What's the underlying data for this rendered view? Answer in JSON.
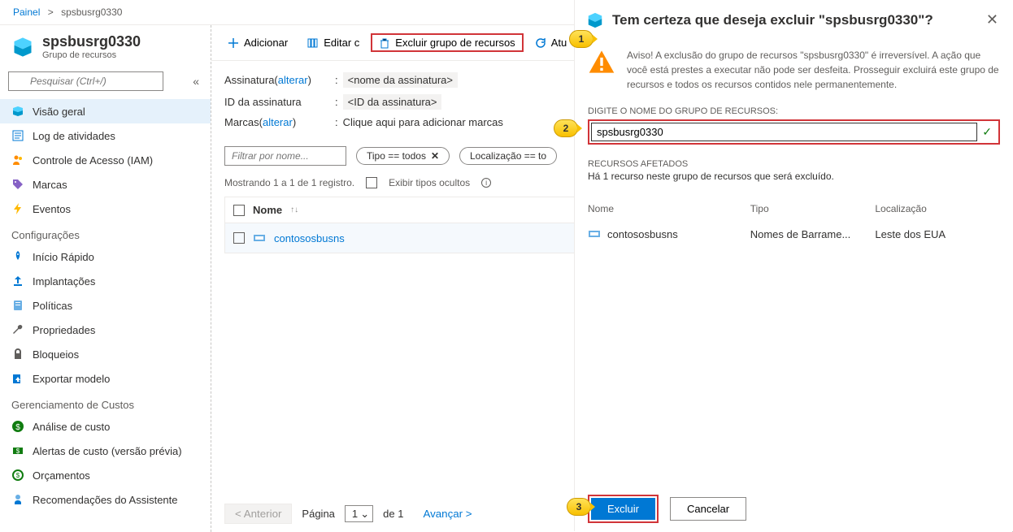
{
  "breadcrumb": {
    "root": "Painel",
    "current": "spsbusrg0330"
  },
  "header": {
    "title": "spsbusrg0330",
    "subtitle": "Grupo de recursos"
  },
  "search": {
    "placeholder": "Pesquisar (Ctrl+/)"
  },
  "nav": {
    "items": [
      {
        "label": "Visão geral"
      },
      {
        "label": "Log de atividades"
      },
      {
        "label": "Controle de Acesso (IAM)"
      },
      {
        "label": "Marcas"
      },
      {
        "label": "Eventos"
      }
    ],
    "config_header": "Configurações",
    "config": [
      {
        "label": "Início Rápido"
      },
      {
        "label": "Implantações"
      },
      {
        "label": "Políticas"
      },
      {
        "label": "Propriedades"
      },
      {
        "label": "Bloqueios"
      },
      {
        "label": "Exportar modelo"
      }
    ],
    "cost_header": "Gerenciamento de Custos",
    "cost": [
      {
        "label": "Análise de custo"
      },
      {
        "label": "Alertas de custo (versão prévia)"
      },
      {
        "label": "Orçamentos"
      },
      {
        "label": "Recomendações do Assistente"
      }
    ]
  },
  "toolbar": {
    "add": "Adicionar",
    "edit": "Editar c",
    "delete": "Excluir grupo de recursos",
    "refresh": "Atu"
  },
  "essentials": {
    "sub_label": "Assinatura",
    "change": "alterar",
    "sub_value": "<nome da assinatura>",
    "subid_label": "ID da assinatura",
    "subid_value": "<ID da assinatura>",
    "tags_label": "Marcas",
    "tags_action": "Clique aqui para adicionar marcas"
  },
  "filters": {
    "name_placeholder": "Filtrar por nome...",
    "type_pill": "Tipo == todos",
    "loc_pill": "Localização == to"
  },
  "listing": {
    "count_text": "Mostrando 1 a 1 de 1 registro.",
    "hidden_types": "Exibir tipos ocultos",
    "col_name": "Nome",
    "rows": [
      {
        "name": "contososbusns"
      }
    ]
  },
  "pager": {
    "prev": "< Anterior",
    "page_label": "Página",
    "page_value": "1",
    "of_label": "de 1",
    "next": "Avançar >"
  },
  "panel": {
    "title": "Tem certeza que deseja excluir \"spsbusrg0330\"?",
    "warning": "Aviso! A exclusão do grupo de recursos \"spsbusrg0330\" é irreversível. A ação que você está prestes a executar não pode ser desfeita. Prosseguir excluirá este grupo de recursos e todos os recursos contidos nele permanentemente.",
    "confirm_label": "DIGITE O NOME DO GRUPO DE RECURSOS:",
    "confirm_value": "spsbusrg0330",
    "affected_header": "RECURSOS AFETADOS",
    "affected_sub": "Há 1 recurso neste grupo de recursos que será excluído.",
    "cols": {
      "name": "Nome",
      "type": "Tipo",
      "loc": "Localização"
    },
    "rows": [
      {
        "name": "contososbusns",
        "type": "Nomes de Barrame...",
        "loc": "Leste dos EUA"
      }
    ],
    "delete_btn": "Excluir",
    "cancel_btn": "Cancelar"
  },
  "callouts": {
    "c1": "1",
    "c2": "2",
    "c3": "3"
  }
}
